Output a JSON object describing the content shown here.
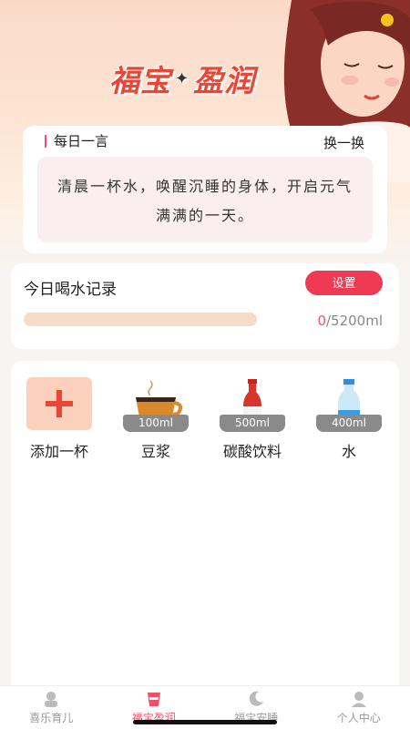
{
  "banner": {
    "title_left": "福宝",
    "separator": "✦",
    "title_right": "盈润"
  },
  "quote": {
    "heading": "每日一言",
    "switch_label": "换一换",
    "text": "清晨一杯水，唤醒沉睡的身体，开启元气满满的一天。"
  },
  "record": {
    "title": "今日喝水记录",
    "setting_label": "设置",
    "current": "0",
    "goal": "/5200ml",
    "progress_fraction": 0.0
  },
  "drinks": [
    {
      "label": "添加一杯",
      "icon": "plus-icon"
    },
    {
      "label": "豆浆",
      "volume": "100ml",
      "icon": "coffee-cup-icon"
    },
    {
      "label": "碳酸饮料",
      "volume": "500ml",
      "icon": "soda-bottle-icon"
    },
    {
      "label": "水",
      "volume": "400ml",
      "icon": "water-bottle-icon"
    }
  ],
  "tabs": [
    {
      "label": "喜乐育儿",
      "icon": "baby-icon"
    },
    {
      "label": "福宝盈润",
      "icon": "cup-icon"
    },
    {
      "label": "福宝安睡",
      "icon": "moon-icon"
    },
    {
      "label": "个人中心",
      "icon": "person-icon"
    }
  ],
  "colors": {
    "accent": "#f0506a",
    "button": "#f03a54",
    "title": "#e84736"
  }
}
